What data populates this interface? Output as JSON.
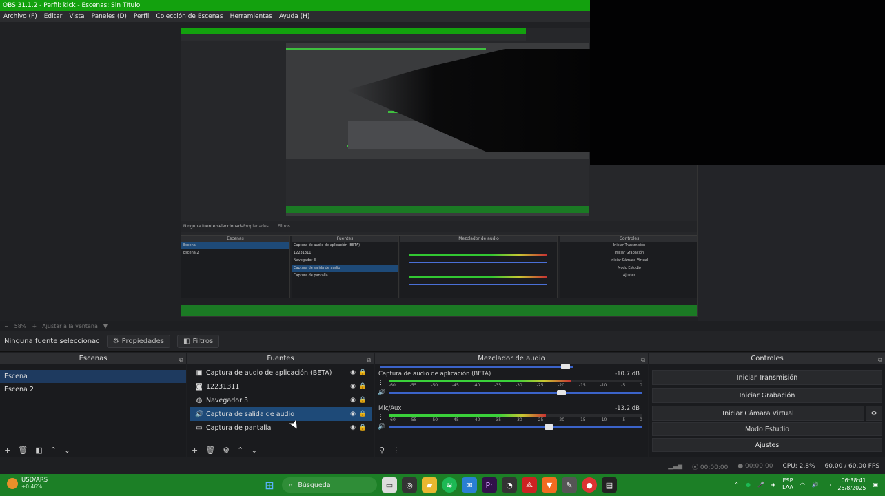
{
  "window": {
    "title": "OBS 31.1.2 - Perfil: kick - Escenas: Sin Título"
  },
  "menu": [
    "Archivo (F)",
    "Editar",
    "Vista",
    "Paneles (D)",
    "Perfil",
    "Colección de Escenas",
    "Herramientas",
    "Ayuda (H)"
  ],
  "zoom": {
    "minus": "−",
    "value": "58%",
    "plus": "+",
    "fit": "Ajustar a la ventana",
    "arrow": "▼"
  },
  "source_bar": {
    "status": "Ninguna fuente seleccionac",
    "properties": "Propiedades",
    "filters": "Filtros"
  },
  "scenes": {
    "title": "Escenas",
    "items": [
      "Escena",
      "Escena 2"
    ]
  },
  "sources": {
    "title": "Fuentes",
    "items": [
      {
        "name": "Captura de audio de aplicación (BETA)",
        "icon": "app-audio-icon"
      },
      {
        "name": "12231311",
        "icon": "camera-icon"
      },
      {
        "name": "Navegador 3",
        "icon": "browser-icon"
      },
      {
        "name": "Captura de salida de audio",
        "icon": "speaker-icon"
      },
      {
        "name": "Captura de pantalla",
        "icon": "monitor-icon"
      }
    ]
  },
  "mixer": {
    "title": "Mezclador de audio",
    "channels": [
      {
        "name": "Captura de audio de aplicación (BETA)",
        "db": "-10.7 dB",
        "level": 0.72,
        "volume": 0.68
      },
      {
        "name": "Mic/Aux",
        "db": "-13.2 dB",
        "level": 0.62,
        "volume": 0.63
      }
    ],
    "ticks": [
      "-60",
      "-55",
      "-50",
      "-45",
      "-40",
      "-35",
      "-30",
      "-25",
      "-20",
      "-15",
      "-10",
      "-5",
      "0"
    ]
  },
  "controls": {
    "title": "Controles",
    "buttons": [
      "Iniciar Transmisión",
      "Iniciar Grabación",
      "Iniciar Cámara Virtual",
      "Modo Estudio",
      "Ajustes"
    ]
  },
  "status": {
    "stream_time": "00:00:00",
    "rec_time": "00:00:00",
    "cpu": "CPU: 2.8%",
    "fps": "60.00 / 60.00 FPS"
  },
  "taskbar": {
    "ticker_name": "USD/ARS",
    "ticker_change": "+0.46%",
    "search": "Búsqueda",
    "lang1": "ESP",
    "lang2": "LAA",
    "time": "06:38:41",
    "date": "25/8/2025"
  },
  "nested": {
    "docks": [
      "Escenas",
      "Fuentes",
      "Mezclador de audio",
      "Controles"
    ],
    "scenes": [
      "Escena",
      "Escena 2"
    ],
    "sources": [
      "Captura de audio de aplicación (BETA)",
      "12231311",
      "Navegador 3",
      "Captura de salida de audio",
      "Captura de pantalla"
    ],
    "controls": [
      "Iniciar Transmisión",
      "Iniciar Grabación",
      "Iniciar Cámara Virtual",
      "Modo Estudio",
      "Ajustes"
    ],
    "no_source": "Ninguna fuente seleccionada",
    "properties": "Propiedades",
    "filters": "Filtros"
  }
}
